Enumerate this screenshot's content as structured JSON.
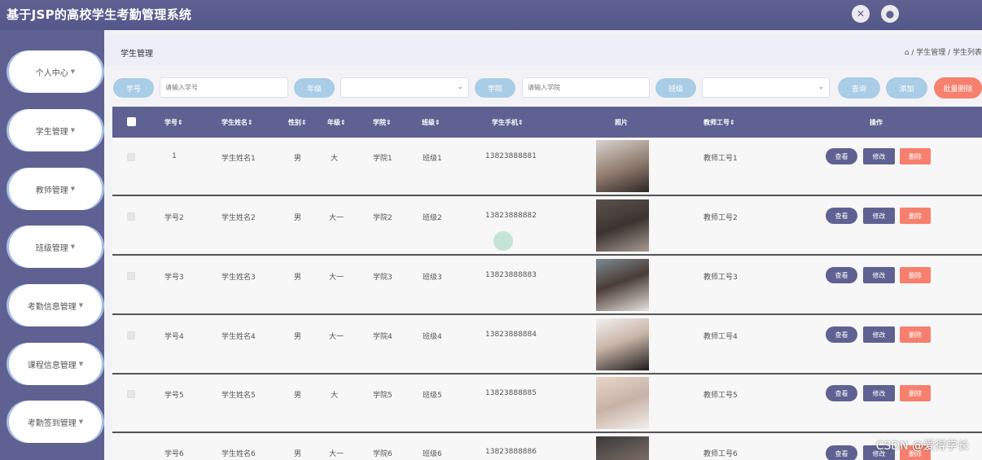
{
  "app": {
    "title": "基于JSP的高校学生考勤管理系统"
  },
  "topbar": {
    "icons": [
      "expand-icon",
      "user-icon"
    ]
  },
  "sidebar": {
    "items": [
      {
        "label": "个人中心"
      },
      {
        "label": "学生管理"
      },
      {
        "label": "教师管理"
      },
      {
        "label": "班级管理"
      },
      {
        "label": "考勤信息管理"
      },
      {
        "label": "课程信息管理"
      },
      {
        "label": "考勤签到管理"
      }
    ]
  },
  "breadcrumb": {
    "title": "学生管理",
    "path": "⌂ / 学生管理 / 学生列表"
  },
  "search": {
    "student_no_label": "学号",
    "student_no_placeholder": "请输入学号",
    "grade_label": "年级",
    "college_label": "学院",
    "college_placeholder": "请输入学院",
    "class_label": "班级",
    "query_button": "查询",
    "add_button": "添加",
    "batch_delete_button": "批量删除"
  },
  "table": {
    "headers": {
      "student_no": "学号⇕",
      "student_name": "学生姓名⇕",
      "gender": "性别⇕",
      "grade": "年级⇕",
      "college": "学院⇕",
      "class": "班级⇕",
      "phone": "学生手机⇕",
      "photo": "照片",
      "teacher_no": "教师工号⇕",
      "actions": "操作"
    },
    "rows": [
      {
        "student_no": "1",
        "student_name": "学生姓名1",
        "gender": "男",
        "grade": "大",
        "college": "学院1",
        "class": "班级1",
        "phone": "13823888881",
        "teacher_no": "教师工号1",
        "view": "查看",
        "edit": "修改",
        "delete": "删除"
      },
      {
        "student_no": "学号2",
        "student_name": "学生姓名2",
        "gender": "男",
        "grade": "大一",
        "college": "学院2",
        "class": "班级2",
        "phone": "13823888882",
        "teacher_no": "教师工号2",
        "view": "查看",
        "edit": "修改",
        "delete": "删除"
      },
      {
        "student_no": "学号3",
        "student_name": "学生姓名3",
        "gender": "男",
        "grade": "大一",
        "college": "学院3",
        "class": "班级3",
        "phone": "13823888883",
        "teacher_no": "教师工号3",
        "view": "查看",
        "edit": "修改",
        "delete": "删除"
      },
      {
        "student_no": "学号4",
        "student_name": "学生姓名4",
        "gender": "男",
        "grade": "大一",
        "college": "学院4",
        "class": "班级4",
        "phone": "13823888884",
        "teacher_no": "教师工号4",
        "view": "查看",
        "edit": "修改",
        "delete": "删除"
      },
      {
        "student_no": "学号5",
        "student_name": "学生姓名5",
        "gender": "男",
        "grade": "大",
        "college": "学院5",
        "class": "班级5",
        "phone": "13823888885",
        "teacher_no": "教师工号5",
        "view": "查看",
        "edit": "修改",
        "delete": "删除"
      },
      {
        "student_no": "学号6",
        "student_name": "学生姓名6",
        "gender": "男",
        "grade": "大一",
        "college": "学院6",
        "class": "班级6",
        "phone": "13823888886",
        "teacher_no": "教师工号6",
        "view": "查看",
        "edit": "修改",
        "delete": "删除"
      }
    ]
  },
  "watermark": "CSDN @爱得学长"
}
